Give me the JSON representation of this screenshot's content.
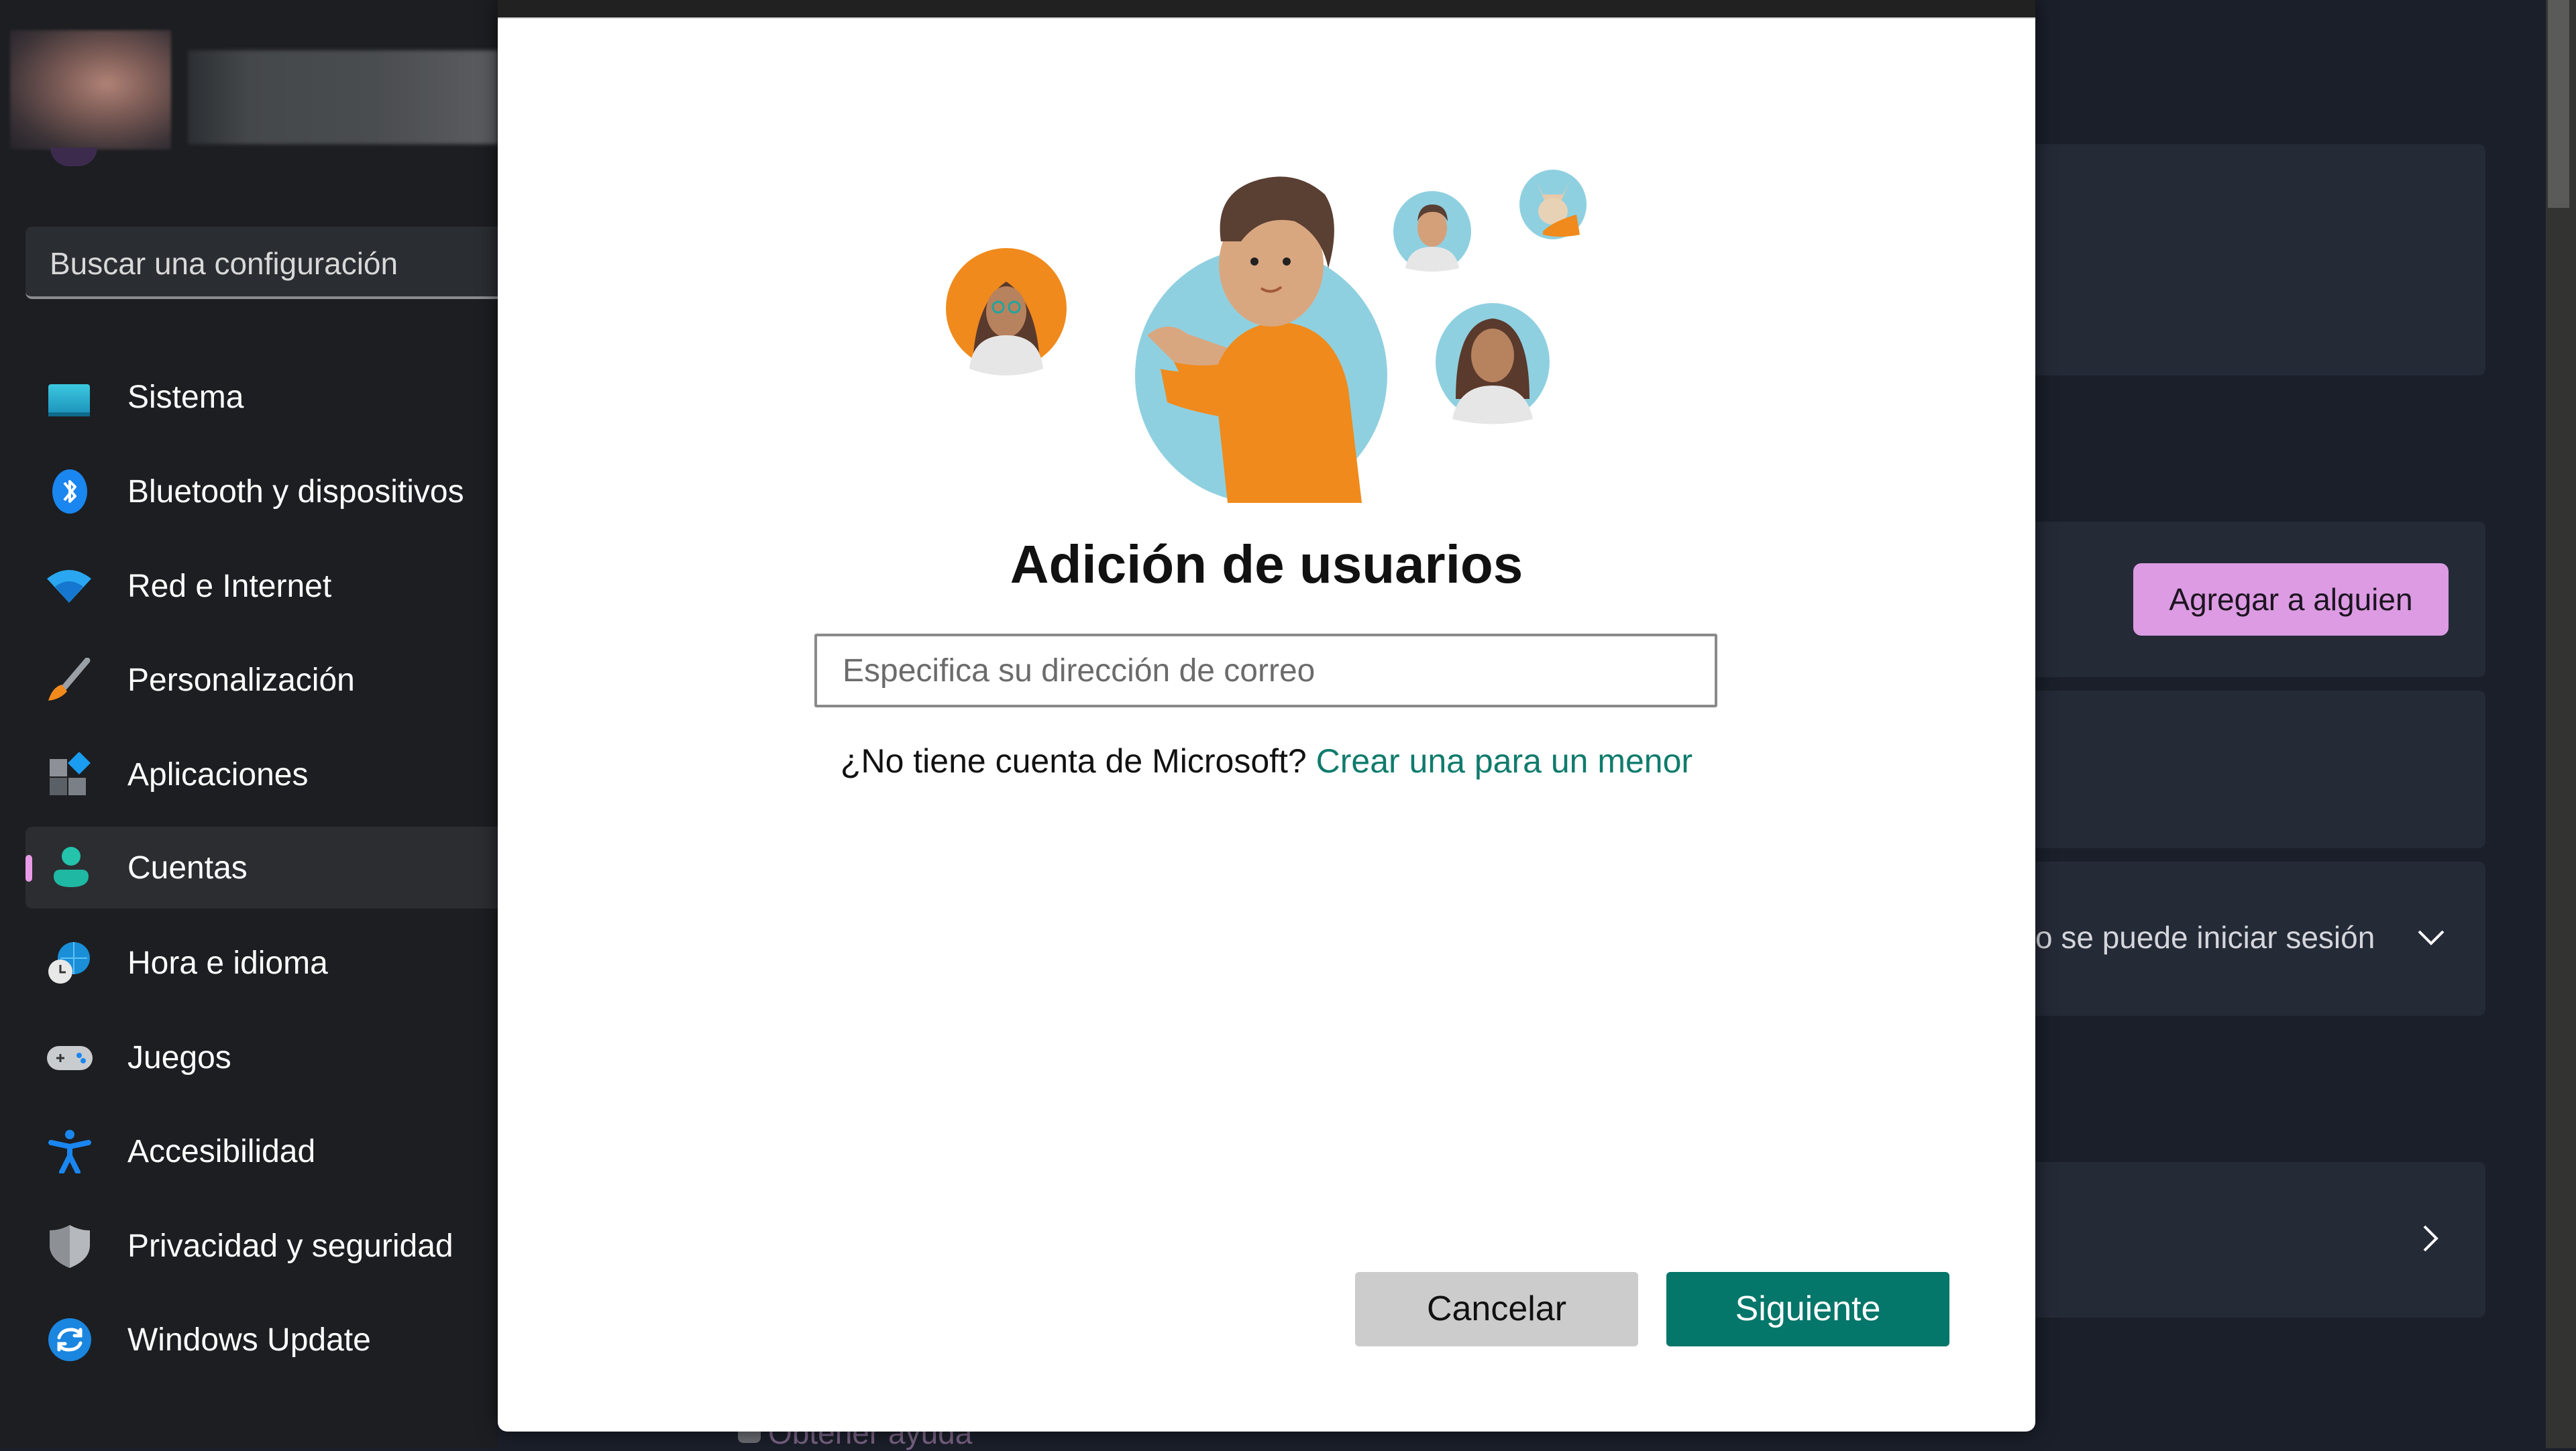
{
  "sidebar": {
    "search_placeholder": "Buscar una configuración",
    "items": [
      {
        "label": "Sistema",
        "icon": "monitor-icon",
        "selected": false
      },
      {
        "label": "Bluetooth y dispositivos",
        "icon": "bluetooth-icon",
        "selected": false
      },
      {
        "label": "Red e Internet",
        "icon": "wifi-icon",
        "selected": false
      },
      {
        "label": "Personalización",
        "icon": "paintbrush-icon",
        "selected": false
      },
      {
        "label": "Aplicaciones",
        "icon": "apps-icon",
        "selected": false
      },
      {
        "label": "Cuentas",
        "icon": "person-icon",
        "selected": true
      },
      {
        "label": "Hora e idioma",
        "icon": "globe-clock-icon",
        "selected": false
      },
      {
        "label": "Juegos",
        "icon": "gamepad-icon",
        "selected": false
      },
      {
        "label": "Accesibilidad",
        "icon": "accessibility-icon",
        "selected": false
      },
      {
        "label": "Privacidad y seguridad",
        "icon": "shield-icon",
        "selected": false
      },
      {
        "label": "Windows Update",
        "icon": "sync-icon",
        "selected": false
      }
    ],
    "accent_color": "#e99be7"
  },
  "background": {
    "add_someone_button": "Agregar a alguien",
    "signin_row_text": "o se puede iniciar sesión",
    "help_link_partial": "Obtener ayuda"
  },
  "dialog": {
    "title": "Adición de usuarios",
    "email_placeholder": "Especifica su dirección de correo",
    "email_value": "",
    "no_account_text": "¿No tiene cuenta de Microsoft?",
    "create_link": "Crear una para un menor",
    "cancel_label": "Cancelar",
    "next_label": "Siguiente",
    "primary_color": "#05766a",
    "link_color": "#0f7b6c"
  }
}
